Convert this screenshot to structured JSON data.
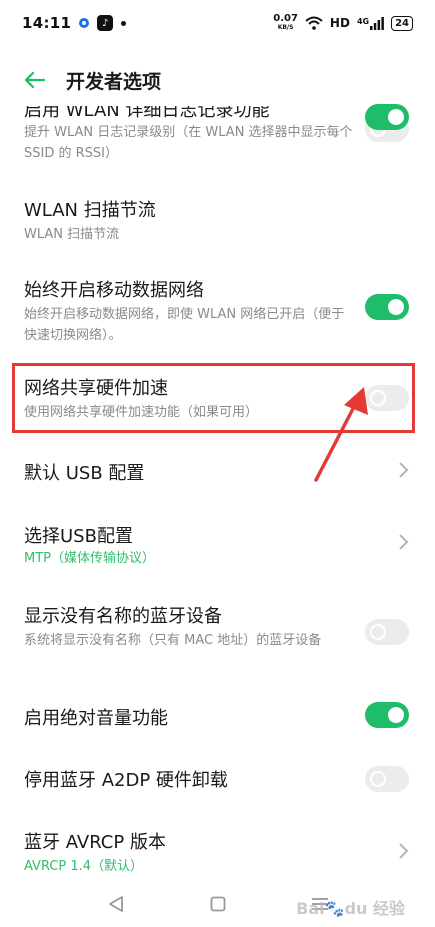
{
  "status_bar": {
    "time": "14:11",
    "speed_value": "0.07",
    "speed_unit": "KB/S",
    "hd": "HD",
    "network": "4G",
    "battery": "24"
  },
  "header": {
    "title": "开发者选项"
  },
  "items": [
    {
      "title": "启用 WLAN 详细日志记录功能",
      "subtitle": "提升 WLAN 日志记录级别（在 WLAN 选择器中显示每个 SSID 的 RSSI）",
      "control": "toggle",
      "on": false
    },
    {
      "title": "WLAN 扫描节流",
      "subtitle": "WLAN 扫描节流",
      "control": "toggle",
      "on": true
    },
    {
      "title": "始终开启移动数据网络",
      "subtitle": "始终开启移动数据网络，即使 WLAN 网络已开启（便于快速切换网络）。",
      "control": "toggle",
      "on": true
    },
    {
      "title": "网络共享硬件加速",
      "subtitle": "使用网络共享硬件加速功能（如果可用）",
      "control": "toggle",
      "on": false
    },
    {
      "title": "默认 USB 配置",
      "control": "chevron"
    },
    {
      "title": "选择USB配置",
      "subtitle": "MTP（媒体传输协议）",
      "control": "chevron"
    },
    {
      "title": "显示没有名称的蓝牙设备",
      "subtitle": "系统将显示没有名称（只有 MAC 地址）的蓝牙设备",
      "control": "toggle",
      "on": false
    },
    {
      "title": "启用绝对音量功能",
      "control": "toggle",
      "on": true
    },
    {
      "title": "停用蓝牙 A2DP 硬件卸载",
      "control": "toggle",
      "on": false
    },
    {
      "title": "蓝牙 AVRCP 版本",
      "subtitle": "AVRCP 1.4（默认）",
      "control": "chevron"
    }
  ],
  "colors": {
    "accent": "#1fbd6a",
    "highlight": "#e53935"
  },
  "watermark": "Baidu 经验"
}
